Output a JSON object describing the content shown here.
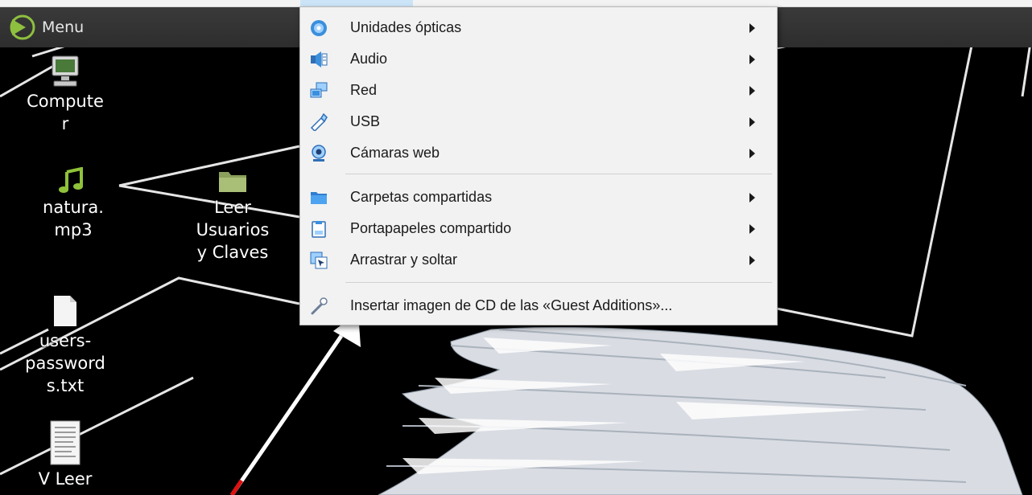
{
  "panel": {
    "menu_label": "Menu",
    "menu_icon": "mint-logo-icon"
  },
  "desktop": {
    "icons": [
      {
        "label": "Compute\nr",
        "icon": "computer-icon"
      },
      {
        "label": "natura.\nmp3",
        "icon": "music-file-icon"
      },
      {
        "label": "Leer\nUsuarios\ny Claves",
        "icon": "folder-icon"
      },
      {
        "label": "users-\npassword\ns.txt",
        "icon": "text-file-icon"
      },
      {
        "label": "V Leer",
        "icon": "document-icon"
      }
    ]
  },
  "devices_menu": {
    "items": [
      {
        "label": "Unidades ópticas",
        "icon": "optical-disc-icon",
        "submenu": true
      },
      {
        "label": "Audio",
        "icon": "audio-icon",
        "submenu": true
      },
      {
        "label": "Red",
        "icon": "network-icon",
        "submenu": true
      },
      {
        "label": "USB",
        "icon": "usb-icon",
        "submenu": true
      },
      {
        "label": "Cámaras web",
        "icon": "webcam-icon",
        "submenu": true
      },
      {
        "label": "Carpetas compartidas",
        "icon": "shared-folder-icon",
        "submenu": true
      },
      {
        "label": "Portapapeles compartido",
        "icon": "clipboard-icon",
        "submenu": true
      },
      {
        "label": "Arrastrar y soltar",
        "icon": "drag-drop-icon",
        "submenu": true
      },
      {
        "label": "Insertar imagen de CD de las «Guest Additions»...",
        "icon": "guest-additions-cd-icon",
        "submenu": false
      }
    ]
  },
  "colors": {
    "menu_background": "#f2f2f2",
    "panel_background": "#333333",
    "desktop_background": "#000000",
    "annotation_arrow": "#ffffff"
  }
}
